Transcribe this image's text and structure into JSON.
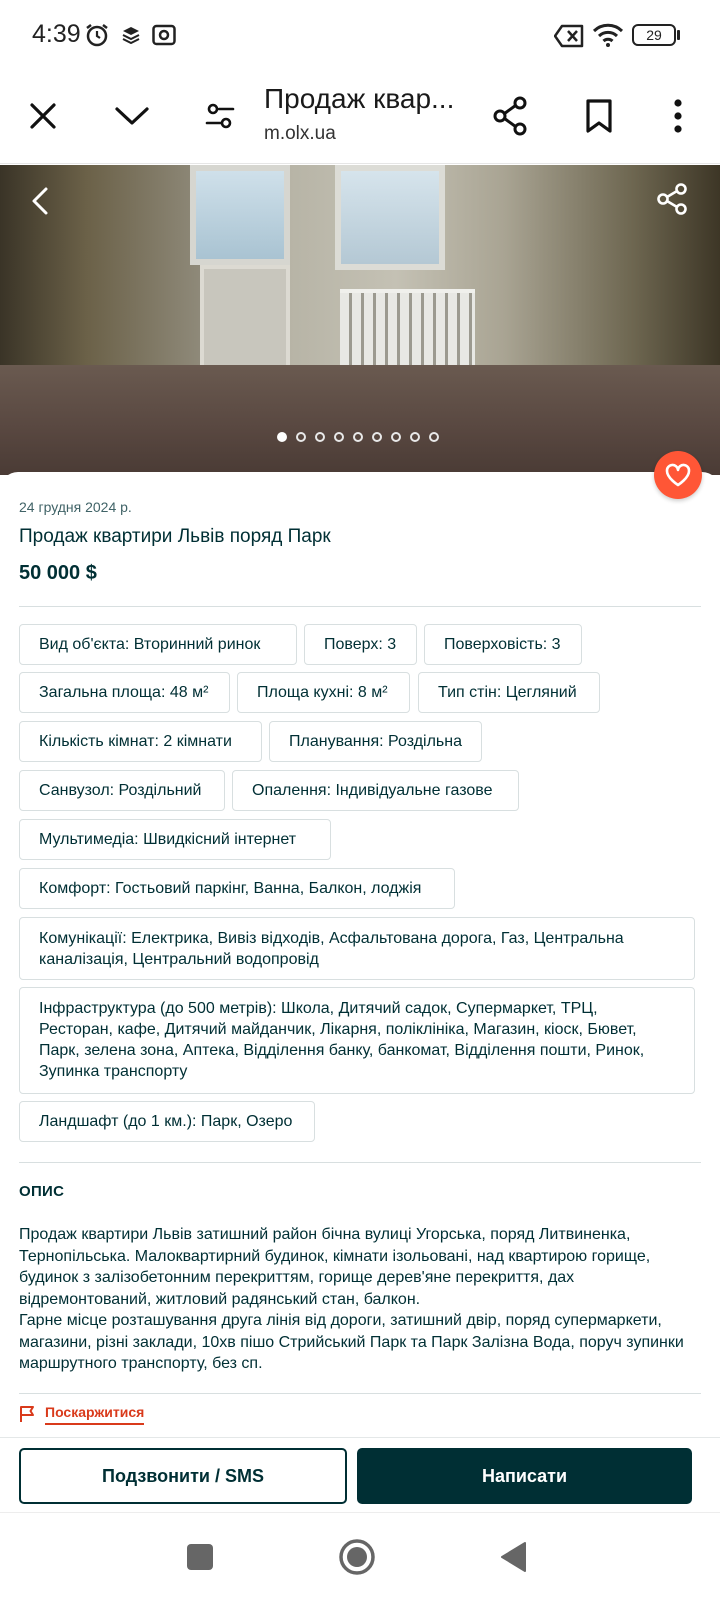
{
  "status_bar": {
    "time": "4:39",
    "battery": "29",
    "icons": [
      "alarm-icon",
      "layers-icon",
      "screen-record-icon",
      "no-sim-icon",
      "wifi-icon",
      "battery-icon"
    ]
  },
  "browser": {
    "page_title": "Продаж квар...",
    "url": "m.olx.ua",
    "icons": [
      "close-icon",
      "chevron-down-icon",
      "page-settings-icon",
      "share-icon",
      "bookmark-icon",
      "more-vert-icon"
    ]
  },
  "gallery": {
    "image_count": 9,
    "active_index": 0
  },
  "listing": {
    "date": "24 грудня 2024 р.",
    "title": "Продаж квартири Львів поряд Парк",
    "price": "50 000 $",
    "params": [
      "Вид об'єкта: Вторинний ринок",
      "Поверх: 3",
      "Поверховість: 3",
      "Загальна площа: 48 м²",
      "Площа кухні: 8 м²",
      "Тип стін: Цегляний",
      "Кількість кімнат: 2 кімнати",
      "Планування: Роздільна",
      "Санвузол: Роздільний",
      "Опалення: Індивідуальне газове",
      "Мультимедіа: Швидкісний інтернет",
      "Комфорт: Гостьовий паркінг, Ванна, Балкон, лоджія",
      "Комунікації: Електрика, Вивіз відходів, Асфальтована дорога, Газ, Центральна каналізація, Центральний водопровід",
      "Інфраструктура (до 500 метрів): Школа, Дитячий садок, Супермаркет, ТРЦ, Ресторан, кафе, Дитячий майданчик, Лікарня, поліклініка, Магазин, кіоск, Бювет, Парк, зелена зона, Аптека, Відділення банку, банкомат, Відділення пошти, Ринок, Зупинка транспорту",
      "Ландшафт (до 1 км.): Парк, Озеро"
    ],
    "description_heading": "ОПИС",
    "description": "Продаж квартири Львів затишний район бічна вулиці Угорська, поряд Литвиненка, Тернопільська. Малоквартирний будинок, кімнати ізольовані, над квартирою горище, будинок з залізобетонним перекриттям, горище дерев'яне перекриття, дах відремонтований, житловий радянський стан, балкон.\nГарне місце розташування друга лінія від дороги, затишний двір, поряд супермаркети, магазини, різні заклади, 10хв пішо Стрийський Парк та Парк Залізна Вода, поруч зупинки маршрутного транспорту, без сп.",
    "report_label": "Поскаржитися"
  },
  "actions": {
    "call_label": "Подзвонити / SMS",
    "write_label": "Написати"
  },
  "colors": {
    "primary": "#002f34",
    "favorite": "#ff5636",
    "report": "#d93a1b"
  }
}
